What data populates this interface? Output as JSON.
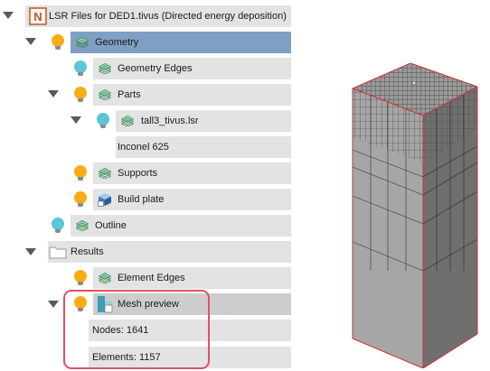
{
  "tree": {
    "root": {
      "label": "LSR Files for DED1.tivus (Directed energy deposition)",
      "logo_text": "N"
    },
    "geometry": {
      "label": "Geometry"
    },
    "geometry_edges": {
      "label": "Geometry Edges"
    },
    "parts": {
      "label": "Parts"
    },
    "part_file": {
      "label": "tall3_tivus.lsr"
    },
    "material": {
      "label": "Inconel 625"
    },
    "supports": {
      "label": "Supports"
    },
    "build_plate": {
      "label": "Build plate"
    },
    "outline": {
      "label": "Outline"
    },
    "results": {
      "label": "Results"
    },
    "element_edges": {
      "label": "Element Edges"
    },
    "mesh_preview": {
      "label": "Mesh preview"
    },
    "nodes": {
      "label": "Nodes: 1641"
    },
    "elements": {
      "label": "Elements: 1157"
    }
  },
  "icons": {
    "expanded": "triangle-down-icon",
    "visible": "lightbulb-on-icon",
    "hidden": "lightbulb-off-icon",
    "geometry": "geometry-icon",
    "folder": "folder-icon",
    "build_plate": "build-plate-icon",
    "mesh": "mesh-icon"
  },
  "colors": {
    "row_bg": "#e3e3e3",
    "selected_bg": "#7f9fc4",
    "bulb_on": "#f8ad14",
    "bulb_off": "#5bc6d6",
    "highlight": "#e05260",
    "mesh_edge": "#d03030"
  }
}
